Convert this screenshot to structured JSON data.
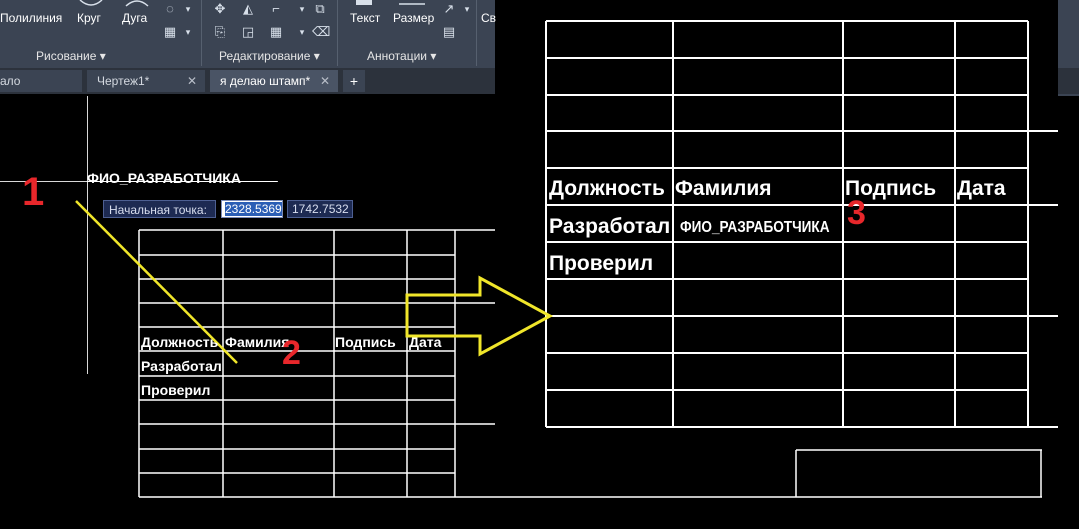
{
  "ribbon": {
    "tools": {
      "polyline": "Полилиния",
      "circle": "Круг",
      "arc": "Дуга",
      "text": "Текст",
      "dimension": "Размер",
      "cut": "Св"
    },
    "panels": {
      "draw": "Рисование ▾",
      "modify": "Редактирование ▾",
      "annotation": "Аннотации ▾"
    }
  },
  "tabs": [
    {
      "label": "ало"
    },
    {
      "label": "Чертеж1*"
    },
    {
      "label": "я делаю штамп*"
    }
  ],
  "tab_close": "✕",
  "tab_add": "+",
  "canvas": {
    "attribute_tag": "ФИО_РАЗРАБОТЧИКА",
    "dynamic_input": {
      "label": "Начальная точка:",
      "x_value": "2328.5369",
      "y_value": "1742.7532"
    },
    "small_table": {
      "headers": [
        "Должность",
        "Фамилия",
        "Подпись",
        "Дата"
      ],
      "rows": [
        "Разработал",
        "Проверил"
      ]
    },
    "big_table": {
      "headers": [
        "Должность",
        "Фамилия",
        "Подпись",
        "Дата"
      ],
      "rows": [
        "Разработал",
        "Проверил"
      ],
      "filled_value": "ФИО_РАЗРАБОТЧИКА"
    },
    "markers": [
      "1",
      "2",
      "3"
    ]
  },
  "colors": {
    "ribbon": "#3b4453",
    "marker": "#e8272b",
    "arrow": "#f0e62a",
    "lines": "#ffffff"
  }
}
